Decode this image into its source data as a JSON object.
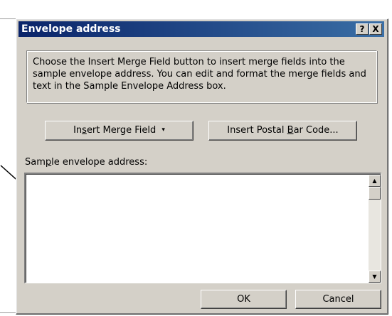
{
  "dialog": {
    "title": "Envelope address",
    "help_label": "?",
    "close_label": "X",
    "instructions_line1": "Choose the Insert Merge Field button to insert merge fields into the",
    "instructions_line2": "sample envelope address.  You can edit and format the merge fields and",
    "instructions_line3": "text in the Sample Envelope Address box.",
    "insert_merge_field": {
      "pre": "In",
      "accel": "s",
      "post": "ert Merge Field",
      "arrow": "▾"
    },
    "insert_postal": {
      "pre": "Insert Postal ",
      "accel": "B",
      "post": "ar Code..."
    },
    "sample_label": {
      "pre": "Sam",
      "accel": "p",
      "post": "le envelope address:"
    },
    "sample_value": "",
    "ok_label": "OK",
    "cancel_label": "Cancel"
  }
}
